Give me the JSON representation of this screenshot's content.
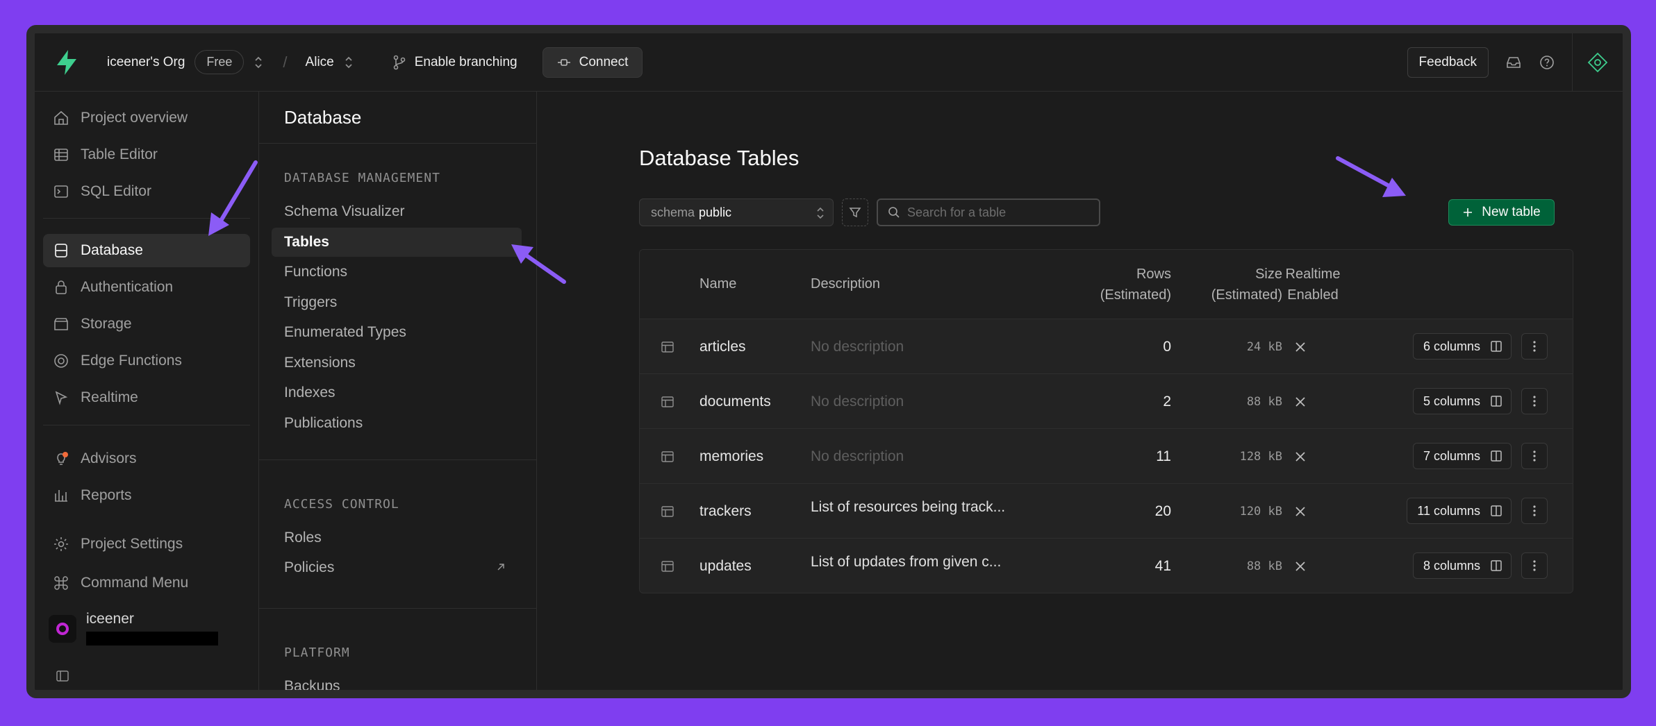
{
  "topbar": {
    "org_name": "iceener's Org",
    "plan_badge": "Free",
    "project_name": "Alice",
    "branching_label": "Enable branching",
    "connect_label": "Connect",
    "feedback_label": "Feedback"
  },
  "sidebar": {
    "items": [
      {
        "label": "Project overview",
        "icon": "home-icon"
      },
      {
        "label": "Table Editor",
        "icon": "table-icon"
      },
      {
        "label": "SQL Editor",
        "icon": "terminal-icon"
      },
      {
        "label": "Database",
        "icon": "database-icon",
        "active": true
      },
      {
        "label": "Authentication",
        "icon": "lock-icon"
      },
      {
        "label": "Storage",
        "icon": "storage-icon"
      },
      {
        "label": "Edge Functions",
        "icon": "edge-functions-icon"
      },
      {
        "label": "Realtime",
        "icon": "cursor-icon"
      },
      {
        "label": "Advisors",
        "icon": "lightbulb-icon"
      },
      {
        "label": "Reports",
        "icon": "chart-icon"
      },
      {
        "label": "Project Settings",
        "icon": "gear-icon"
      },
      {
        "label": "Command Menu",
        "icon": "command-icon"
      }
    ],
    "user_name": "iceener"
  },
  "subnav": {
    "title": "Database",
    "sections": [
      {
        "label": "DATABASE MANAGEMENT",
        "items": [
          "Schema Visualizer",
          "Tables",
          "Functions",
          "Triggers",
          "Enumerated Types",
          "Extensions",
          "Indexes",
          "Publications"
        ]
      },
      {
        "label": "ACCESS CONTROL",
        "items": [
          "Roles",
          "Policies"
        ]
      },
      {
        "label": "PLATFORM",
        "items": [
          "Backups"
        ]
      }
    ],
    "active_item": "Tables"
  },
  "main": {
    "title": "Database Tables",
    "schema_label": "schema",
    "schema_value": "public",
    "search_placeholder": "Search for a table",
    "new_table_label": "New table",
    "columns": {
      "name": "Name",
      "description": "Description",
      "rows_line1": "Rows",
      "rows_line2": "(Estimated)",
      "size_line1": "Size",
      "size_line2": "(Estimated)",
      "realtime_line1": "Realtime",
      "realtime_line2": "Enabled"
    },
    "rows": [
      {
        "name": "articles",
        "description": "No description",
        "muted": true,
        "rows": "0",
        "size": "24 kB",
        "columns": "6 columns"
      },
      {
        "name": "documents",
        "description": "No description",
        "muted": true,
        "rows": "2",
        "size": "88 kB",
        "columns": "5 columns"
      },
      {
        "name": "memories",
        "description": "No description",
        "muted": true,
        "rows": "11",
        "size": "128 kB",
        "columns": "7 columns"
      },
      {
        "name": "trackers",
        "description": "List of resources being track...",
        "muted": false,
        "rows": "20",
        "size": "120 kB",
        "columns": "11 columns"
      },
      {
        "name": "updates",
        "description": "List of updates from given c...",
        "muted": false,
        "rows": "41",
        "size": "88 kB",
        "columns": "8 columns"
      }
    ]
  },
  "colors": {
    "background": "#7f3ef0",
    "brand_green": "#3ecf8e",
    "primary_button": "#006239",
    "annotation_arrow": "#8b5cf6"
  }
}
